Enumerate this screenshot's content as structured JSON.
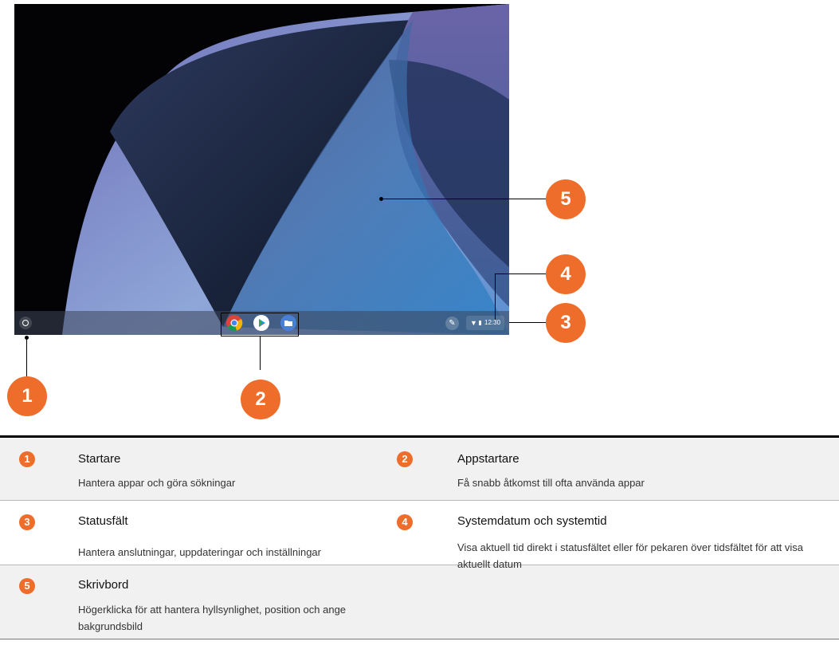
{
  "shelf": {
    "time": "12:30",
    "pinned_apps": [
      {
        "name": "chrome-icon"
      },
      {
        "name": "play-store-icon"
      },
      {
        "name": "files-icon"
      }
    ]
  },
  "callouts": [
    "1",
    "2",
    "3",
    "4",
    "5"
  ],
  "legend": [
    {
      "num": "1",
      "title": "Startare",
      "desc": "Hantera appar och göra sökningar"
    },
    {
      "num": "2",
      "title": "Appstartare",
      "desc": "Få snabb åtkomst till ofta använda appar"
    },
    {
      "num": "3",
      "title": "Statusfält",
      "desc": "Hantera anslutningar, uppdateringar och inställningar"
    },
    {
      "num": "4",
      "title": "Systemdatum och systemtid",
      "desc": "Visa aktuell tid direkt i statusfältet eller för pekaren över tidsfältet för att visa aktuellt datum"
    },
    {
      "num": "5",
      "title": "Skrivbord",
      "desc": "Högerklicka för att hantera hyllsynlighet, position och ange bakgrundsbild"
    }
  ],
  "colors": {
    "accent": "#ee6d2b"
  }
}
